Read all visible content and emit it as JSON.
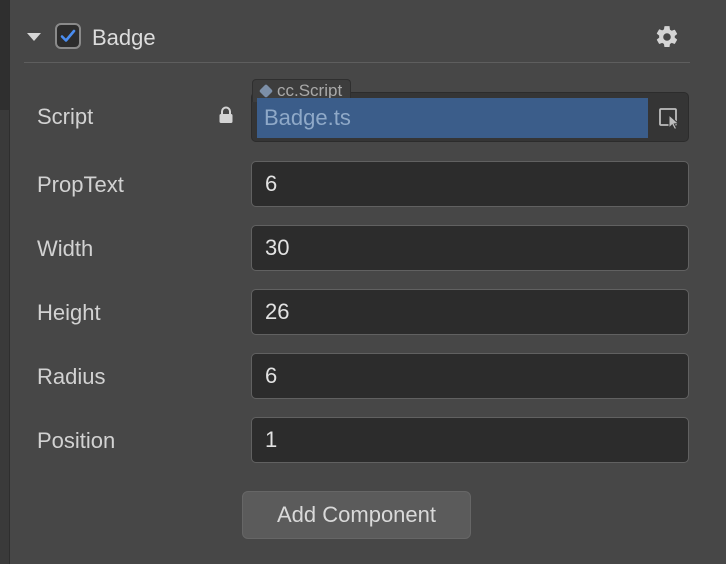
{
  "component": {
    "title": "Badge",
    "enabled": true
  },
  "script": {
    "label": "Script",
    "type_tag": "cc.Script",
    "asset": "Badge.ts"
  },
  "properties": [
    {
      "label": "PropText",
      "value": "6"
    },
    {
      "label": "Width",
      "value": "30"
    },
    {
      "label": "Height",
      "value": "26"
    },
    {
      "label": "Radius",
      "value": "6"
    },
    {
      "label": "Position",
      "value": "1"
    }
  ],
  "add_component_label": "Add Component",
  "icons": {
    "collapse": "triangle-down-icon",
    "enabled": "checkbox-checked-icon",
    "settings": "gear-icon",
    "lock": "lock-icon",
    "select": "cursor-select-icon"
  },
  "colors": {
    "panel_bg": "#474747",
    "field_bg": "#2c2c2c",
    "asset_highlight": "#3b5d8a",
    "check_accent": "#4a8df0"
  }
}
